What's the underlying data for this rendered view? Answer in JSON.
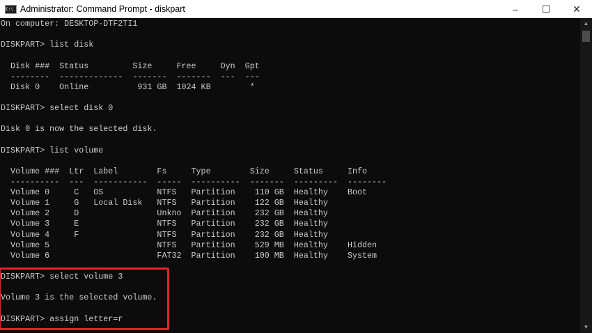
{
  "window": {
    "title": "Administrator: Command Prompt - diskpart",
    "minimize_icon": "–",
    "maximize_icon": "☐",
    "close_icon": "✕",
    "highlight_color": "#e3242b"
  },
  "console": {
    "lines": [
      "On computer: DESKTOP-DTF2TI1",
      "",
      "DISKPART> list disk",
      "",
      "  Disk ###  Status         Size     Free     Dyn  Gpt",
      "  --------  -------------  -------  -------  ---  ---",
      "  Disk 0    Online          931 GB  1024 KB        *",
      "",
      "DISKPART> select disk 0",
      "",
      "Disk 0 is now the selected disk.",
      "",
      "DISKPART> list volume",
      "",
      "  Volume ###  Ltr  Label        Fs     Type        Size     Status     Info",
      "  ----------  ---  -----------  -----  ----------  -------  ---------  --------",
      "  Volume 0     C   OS           NTFS   Partition    110 GB  Healthy    Boot",
      "  Volume 1     G   Local Disk   NTFS   Partition    122 GB  Healthy",
      "  Volume 2     D                Unkno  Partition    232 GB  Healthy",
      "  Volume 3     E                NTFS   Partition    232 GB  Healthy",
      "  Volume 4     F                NTFS   Partition    232 GB  Healthy",
      "  Volume 5                      NTFS   Partition    529 MB  Healthy    Hidden",
      "  Volume 6                      FAT32  Partition    100 MB  Healthy    System",
      "",
      "DISKPART> select volume 3",
      "",
      "Volume 3 is the selected volume.",
      "",
      "DISKPART> assign letter=r"
    ]
  },
  "scrollbar": {
    "up_icon": "▲",
    "down_icon": "▼"
  }
}
